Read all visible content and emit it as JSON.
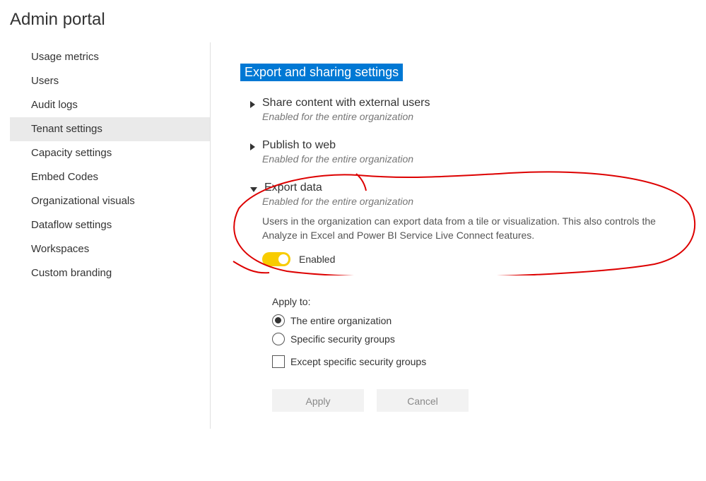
{
  "header": {
    "title": "Admin portal"
  },
  "sidebar": {
    "items": [
      {
        "label": "Usage metrics",
        "selected": false
      },
      {
        "label": "Users",
        "selected": false
      },
      {
        "label": "Audit logs",
        "selected": false
      },
      {
        "label": "Tenant settings",
        "selected": true
      },
      {
        "label": "Capacity settings",
        "selected": false
      },
      {
        "label": "Embed Codes",
        "selected": false
      },
      {
        "label": "Organizational visuals",
        "selected": false
      },
      {
        "label": "Dataflow settings",
        "selected": false
      },
      {
        "label": "Workspaces",
        "selected": false
      },
      {
        "label": "Custom branding",
        "selected": false
      }
    ]
  },
  "main": {
    "section_title": "Export and sharing settings",
    "settings": {
      "share_external": {
        "title": "Share content with external users",
        "status": "Enabled for the entire organization"
      },
      "publish_web": {
        "title": "Publish to web",
        "status": "Enabled for the entire organization"
      },
      "export_data": {
        "title": "Export data",
        "status": "Enabled for the entire organization",
        "description": "Users in the organization can export data from a tile or visualization. This also controls the Analyze in Excel and Power BI Service Live Connect features.",
        "toggle_label": "Enabled",
        "apply_to_label": "Apply to:",
        "apply_options": {
          "entire_org": "The entire organization",
          "specific_groups": "Specific security groups"
        },
        "except_label": "Except specific security groups",
        "buttons": {
          "apply": "Apply",
          "cancel": "Cancel"
        }
      }
    }
  }
}
